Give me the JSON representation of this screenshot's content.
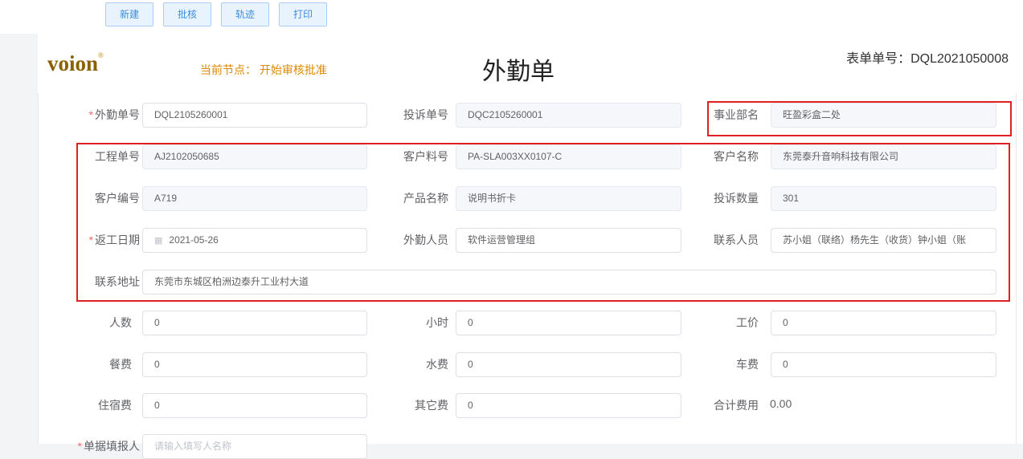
{
  "toolbar": {
    "new_label": "新建",
    "approve_label": "批核",
    "track_label": "轨迹",
    "print_label": "打印"
  },
  "header": {
    "logo_text": "voion",
    "logo_mark": "®",
    "current_node": "当前节点： 开始审核批准",
    "title": "外勤单",
    "form_no": "表单单号：DQL2021050008"
  },
  "form": {
    "fieldwork_no": {
      "label": "外勤单号",
      "value": "DQL2105260001"
    },
    "complaint_no": {
      "label": "投诉单号",
      "value": "DQC2105260001"
    },
    "division": {
      "label": "事业部名",
      "value": "旺盈彩盒二处"
    },
    "project_no": {
      "label": "工程单号",
      "value": "AJ2102050685"
    },
    "customer_part_no": {
      "label": "客户料号",
      "value": "PA-SLA003XX0107-C"
    },
    "customer_name": {
      "label": "客户名称",
      "value": "东莞泰升音响科技有限公司"
    },
    "customer_code": {
      "label": "客户编号",
      "value": "A719"
    },
    "product_name": {
      "label": "产品名称",
      "value": "说明书折卡"
    },
    "complaint_qty": {
      "label": "投诉数量",
      "value": "301"
    },
    "rework_date": {
      "label": "返工日期",
      "value": "2021-05-26"
    },
    "field_staff": {
      "label": "外勤人员",
      "value": "软件运营管理组"
    },
    "contact_person": {
      "label": "联系人员",
      "value": "苏小姐（联络）杨先生（收货）钟小姐（账"
    },
    "contact_address": {
      "label": "联系地址",
      "value": "东莞市东城区柏洲边泰升工业村大道"
    },
    "headcount": {
      "label": "人数",
      "value": "0"
    },
    "hours": {
      "label": "小时",
      "value": "0"
    },
    "wage": {
      "label": "工价",
      "value": "0"
    },
    "meal_fee": {
      "label": "餐费",
      "value": "0"
    },
    "water_fee": {
      "label": "水费",
      "value": "0"
    },
    "travel_fee": {
      "label": "车费",
      "value": "0"
    },
    "lodging_fee": {
      "label": "住宿费",
      "value": "0"
    },
    "other_fee": {
      "label": "其它费",
      "value": "0"
    },
    "total_fee": {
      "label": "合计费用",
      "value": "0.00"
    },
    "document_filler": {
      "label": "单据填报人",
      "placeholder": "请输入填写人名称"
    }
  },
  "colors": {
    "highlight": "#e02020",
    "accent": "#3d8ee0",
    "node_text": "#e08a00",
    "required": "#f56c6c"
  }
}
